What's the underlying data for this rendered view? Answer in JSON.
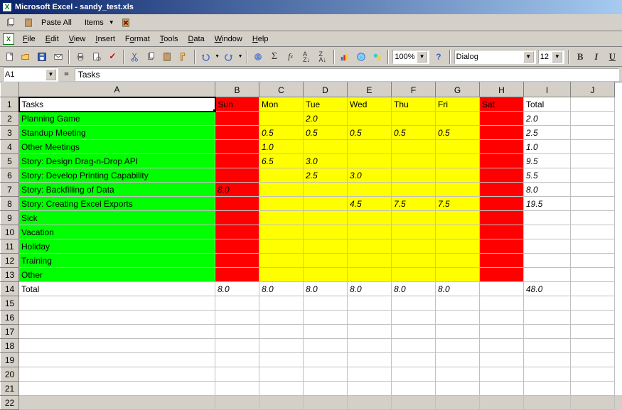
{
  "app": {
    "title": "Microsoft Excel - sandy_test.xls"
  },
  "clip_toolbar": {
    "paste_all": "Paste All",
    "items": "Items"
  },
  "menus": [
    "File",
    "Edit",
    "View",
    "Insert",
    "Format",
    "Tools",
    "Data",
    "Window",
    "Help"
  ],
  "toolbar3": {
    "zoom": "100%",
    "font": "Dialog",
    "size": "12",
    "bold": "B",
    "italic": "I",
    "underline": "U"
  },
  "namebox": {
    "ref": "A1",
    "eq": "=",
    "formula": "Tasks"
  },
  "columns": [
    "A",
    "B",
    "C",
    "D",
    "E",
    "F",
    "G",
    "H",
    "I",
    "J"
  ],
  "header_row": [
    "Tasks",
    "Sun",
    "Mon",
    "Tue",
    "Wed",
    "Thu",
    "Fri",
    "Sat",
    "Total"
  ],
  "rows": [
    {
      "label": "Planning Game",
      "cells": [
        "",
        "",
        "2.0",
        "",
        "",
        "",
        "",
        "2.0"
      ]
    },
    {
      "label": "Standup Meeting",
      "cells": [
        "",
        "0.5",
        "0.5",
        "0.5",
        "0.5",
        "0.5",
        "",
        "2.5"
      ]
    },
    {
      "label": "Other Meetings",
      "cells": [
        "",
        "1.0",
        "",
        "",
        "",
        "",
        "",
        "1.0"
      ]
    },
    {
      "label": "Story: Design Drag-n-Drop API",
      "cells": [
        "",
        "6.5",
        "3.0",
        "",
        "",
        "",
        "",
        "9.5"
      ]
    },
    {
      "label": "Story: Develop Printing Capability",
      "cells": [
        "",
        "",
        "2.5",
        "3.0",
        "",
        "",
        "",
        "5.5"
      ]
    },
    {
      "label": "Story: Backfilling of Data",
      "cells": [
        "8.0",
        "",
        "",
        "",
        "",
        "",
        "",
        "8.0"
      ]
    },
    {
      "label": "Story: Creating Excel Exports",
      "cells": [
        "",
        "",
        "",
        "4.5",
        "7.5",
        "7.5",
        "",
        "19.5"
      ]
    },
    {
      "label": "Sick",
      "cells": [
        "",
        "",
        "",
        "",
        "",
        "",
        "",
        ""
      ]
    },
    {
      "label": "Vacation",
      "cells": [
        "",
        "",
        "",
        "",
        "",
        "",
        "",
        ""
      ]
    },
    {
      "label": "Holiday",
      "cells": [
        "",
        "",
        "",
        "",
        "",
        "",
        "",
        ""
      ]
    },
    {
      "label": "Training",
      "cells": [
        "",
        "",
        "",
        "",
        "",
        "",
        "",
        ""
      ]
    },
    {
      "label": "Other",
      "cells": [
        "",
        "",
        "",
        "",
        "",
        "",
        "",
        ""
      ]
    }
  ],
  "totals": {
    "label": "Total",
    "cells": [
      "8.0",
      "8.0",
      "8.0",
      "8.0",
      "8.0",
      "8.0",
      "",
      "48.0"
    ]
  },
  "chart_data": {
    "type": "table",
    "title": "Weekly task hours",
    "columns": [
      "Task",
      "Sun",
      "Mon",
      "Tue",
      "Wed",
      "Thu",
      "Fri",
      "Sat",
      "Total"
    ],
    "rows": [
      [
        "Planning Game",
        null,
        null,
        2.0,
        null,
        null,
        null,
        null,
        2.0
      ],
      [
        "Standup Meeting",
        null,
        0.5,
        0.5,
        0.5,
        0.5,
        0.5,
        null,
        2.5
      ],
      [
        "Other Meetings",
        null,
        1.0,
        null,
        null,
        null,
        null,
        null,
        1.0
      ],
      [
        "Story: Design Drag-n-Drop API",
        null,
        6.5,
        3.0,
        null,
        null,
        null,
        null,
        9.5
      ],
      [
        "Story: Develop Printing Capability",
        null,
        null,
        2.5,
        3.0,
        null,
        null,
        null,
        5.5
      ],
      [
        "Story: Backfilling of Data",
        8.0,
        null,
        null,
        null,
        null,
        null,
        null,
        8.0
      ],
      [
        "Story: Creating Excel Exports",
        null,
        null,
        null,
        4.5,
        7.5,
        7.5,
        null,
        19.5
      ],
      [
        "Sick",
        null,
        null,
        null,
        null,
        null,
        null,
        null,
        null
      ],
      [
        "Vacation",
        null,
        null,
        null,
        null,
        null,
        null,
        null,
        null
      ],
      [
        "Holiday",
        null,
        null,
        null,
        null,
        null,
        null,
        null,
        null
      ],
      [
        "Training",
        null,
        null,
        null,
        null,
        null,
        null,
        null,
        null
      ],
      [
        "Other",
        null,
        null,
        null,
        null,
        null,
        null,
        null,
        null
      ],
      [
        "Total",
        8.0,
        8.0,
        8.0,
        8.0,
        8.0,
        8.0,
        null,
        48.0
      ]
    ]
  }
}
